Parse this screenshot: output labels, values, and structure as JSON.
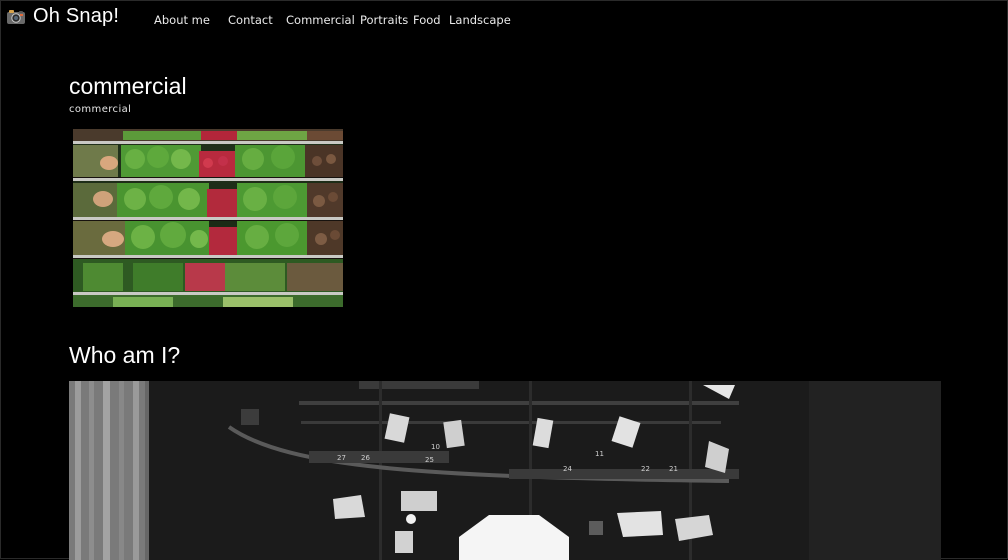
{
  "brand": {
    "name": "Oh Snap!",
    "icon": "camera-icon"
  },
  "nav": {
    "items": [
      {
        "label": "About me"
      },
      {
        "label": "Contact"
      },
      {
        "label": "Commercial"
      },
      {
        "label": "Portraits"
      },
      {
        "label": "Food"
      },
      {
        "label": "Landscape"
      }
    ]
  },
  "section": {
    "title": "commercial",
    "subtitle": "commercial"
  },
  "about": {
    "title": "Who am I?"
  },
  "studio": {
    "truss_labels": [
      "27",
      "26",
      "25",
      "10",
      "11",
      "22",
      "21",
      "24"
    ]
  }
}
